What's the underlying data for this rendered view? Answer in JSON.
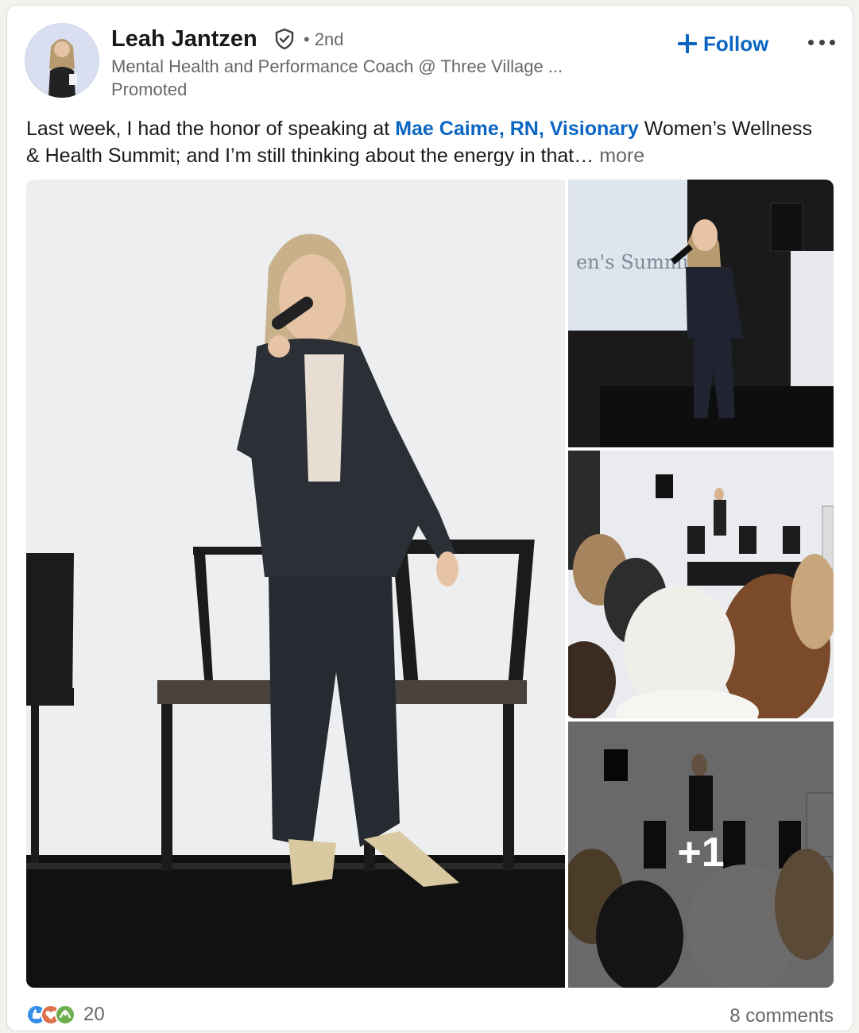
{
  "author": {
    "name": "Leah Jantzen",
    "degree": "• 2nd",
    "headline": "Mental Health and Performance Coach @ Three Village ...",
    "status": "Promoted"
  },
  "actions": {
    "follow_label": "Follow"
  },
  "post": {
    "text_before": "Last week, I had the honor of speaking at ",
    "mention": "Mae Caime, RN, Visionary",
    "text_after": " Women’s Wellness & Health Summit; and I’m still thinking about the energy in that… ",
    "see_more": "more"
  },
  "gallery": {
    "extra_count": "+1"
  },
  "social": {
    "reaction_count": "20",
    "comments": "8 comments"
  },
  "colors": {
    "accent": "#0a66c2",
    "like": "#378fe9",
    "love": "#df704d",
    "support": "#6dae4f"
  }
}
